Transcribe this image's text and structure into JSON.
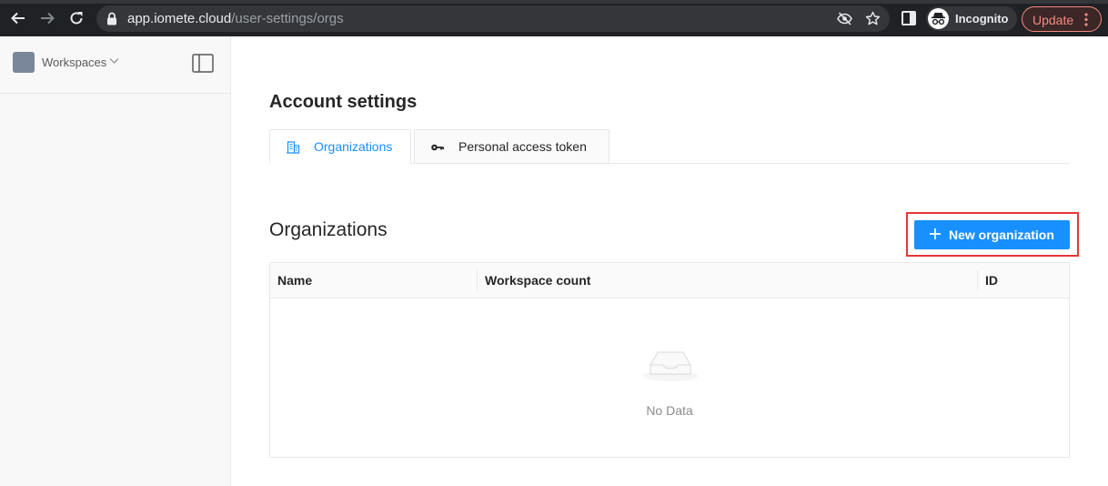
{
  "browser": {
    "url_host": "app.iomete.cloud",
    "url_path": "/user-settings/orgs",
    "incognito_label": "Incognito",
    "update_label": "Update"
  },
  "sidebar": {
    "workspace_label": "Workspaces"
  },
  "main": {
    "page_title": "Account settings",
    "tabs": [
      {
        "label": "Organizations",
        "icon": "building-icon",
        "active": true
      },
      {
        "label": "Personal access token",
        "icon": "key-icon",
        "active": false
      }
    ],
    "section_title": "Organizations",
    "new_button_label": "New organization",
    "table": {
      "columns": [
        "Name",
        "Workspace count",
        "ID"
      ],
      "rows": [],
      "empty_text": "No Data"
    }
  },
  "colors": {
    "accent": "#1890ff",
    "highlight": "#e53935",
    "browser_bg": "#202124"
  }
}
